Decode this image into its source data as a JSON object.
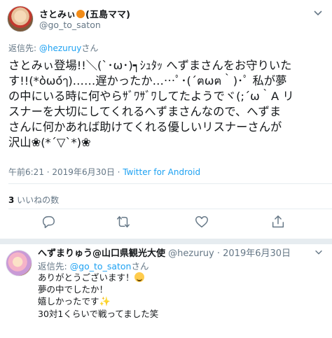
{
  "tweet": {
    "display_name": "さとみぃ",
    "name_suffix": "(五島ママ)",
    "handle": "@go_to_saton",
    "reply_prefix": "返信先: ",
    "reply_handle": "@hezuruy",
    "reply_suffix": "さん",
    "lines": [
      "さとみぃ登場!!＼(`･ω･)┑ｼｭﾀｯ へずまさんをお守りいた",
      "す!!(*ȯ̀ωȯ́ๅ)……遅かったか……ﾟ･(´ฅωฅ｀)･ﾟ 私が夢",
      "の中にいる時に何やらｻﾞﾜｻﾞﾜしてたようでヾ(;´ω｀A リ",
      "スナーを大切にしてくれるへずまさんなので、へずま",
      "さんに何かあれば助けてくれる優しいリスナーさんが",
      "沢山❀(*´▽`*)❀"
    ],
    "time": "午前6:21",
    "date": "2019年6月30日",
    "meta_sep": " · ",
    "source": "Twitter for Android",
    "likes_count": "3",
    "likes_label": " いいねの数"
  },
  "reply": {
    "name": "へずまりゅう@山口県観光大使",
    "handle": "@hezuruy",
    "dot": " · ",
    "date": "2019年6月30日",
    "to_prefix": "返信先: ",
    "to_handle": "@go_to_saton",
    "to_suffix": "さん",
    "line1": "ありがとうございます！",
    "line2": "夢の中でしたか！",
    "line3": "嬉しかったです",
    "line4": "30対1くらいで戦ってました笑"
  },
  "colors": {
    "accent": "#1da1f2",
    "muted": "#657786",
    "divider": "#e6ecf0",
    "orange": "#f28c18"
  },
  "icons": [
    "chevron-down-icon",
    "reply-icon",
    "retweet-icon",
    "like-icon",
    "share-icon",
    "orange-emoji-icon",
    "smile-emoji-icon",
    "sparkles-emoji-icon"
  ]
}
